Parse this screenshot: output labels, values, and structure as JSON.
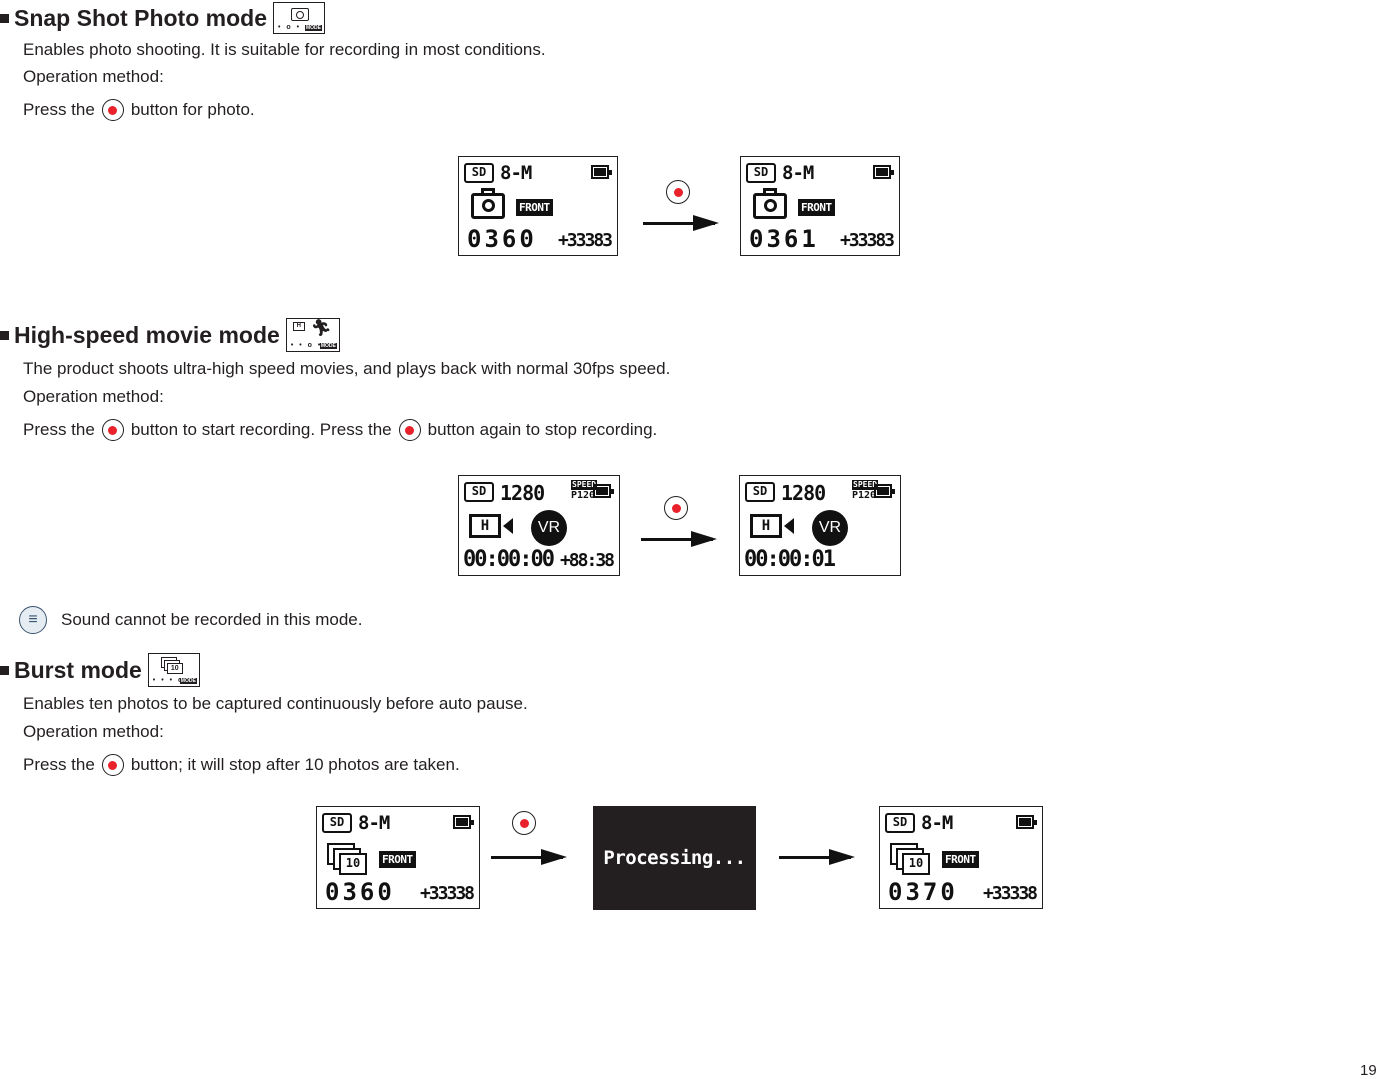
{
  "sections": {
    "snap": {
      "title": "Snap Shot Photo mode",
      "mode_icon": "camera-mode-icon",
      "description": "Enables photo shooting. It is suitable for recording in most conditions.",
      "operation_label": "Operation method:",
      "instruction_pre": "Press the",
      "instruction_post": "button for photo.",
      "screen_before": {
        "storage": "SD",
        "resolution": "8-M",
        "lens": "FRONT",
        "count": "0360",
        "remaining": "+33383"
      },
      "screen_after": {
        "storage": "SD",
        "resolution": "8-M",
        "lens": "FRONT",
        "count": "0361",
        "remaining": "+33383"
      }
    },
    "highspeed": {
      "title": "High-speed movie mode",
      "mode_icon": "high-speed-movie-mode-icon",
      "description": "The product shoots ultra-high speed movies, and plays back with normal 30fps speed.",
      "operation_label": "Operation method:",
      "instruction_pre": "Press the",
      "instruction_mid": "button to start recording. Press the",
      "instruction_post": "button again to stop recording.",
      "screen_before": {
        "storage": "SD",
        "resolution": "1280",
        "speed_tag": "SPEED",
        "fps": "P120",
        "quality": "H",
        "vr": "VR",
        "time": "00:00:00",
        "remaining": "+88:38"
      },
      "screen_after": {
        "storage": "SD",
        "resolution": "1280",
        "speed_tag": "SPEED",
        "fps": "P120",
        "quality": "H",
        "vr": "VR",
        "time": "00:00:01"
      },
      "note": "Sound cannot be recorded in this mode."
    },
    "burst": {
      "title": "Burst mode",
      "mode_icon": "burst-mode-icon",
      "description": "Enables ten photos to be captured continuously before auto pause.",
      "operation_label": "Operation method:",
      "instruction_pre": "Press the",
      "instruction_post": "button; it will stop after 10 photos are taken.",
      "screen_before": {
        "storage": "SD",
        "resolution": "8-M",
        "burst_count": "10",
        "lens": "FRONT",
        "count": "0360",
        "remaining": "+33338"
      },
      "processing_text": "Processing...",
      "screen_after": {
        "storage": "SD",
        "resolution": "8-M",
        "burst_count": "10",
        "lens": "FRONT",
        "count": "0370",
        "remaining": "+33338"
      }
    }
  },
  "mode_tag": "MODE",
  "colors": {
    "record_dot": "#e8212b",
    "text": "#231f20",
    "note_icon": "#3a5570"
  },
  "page_number": "19"
}
